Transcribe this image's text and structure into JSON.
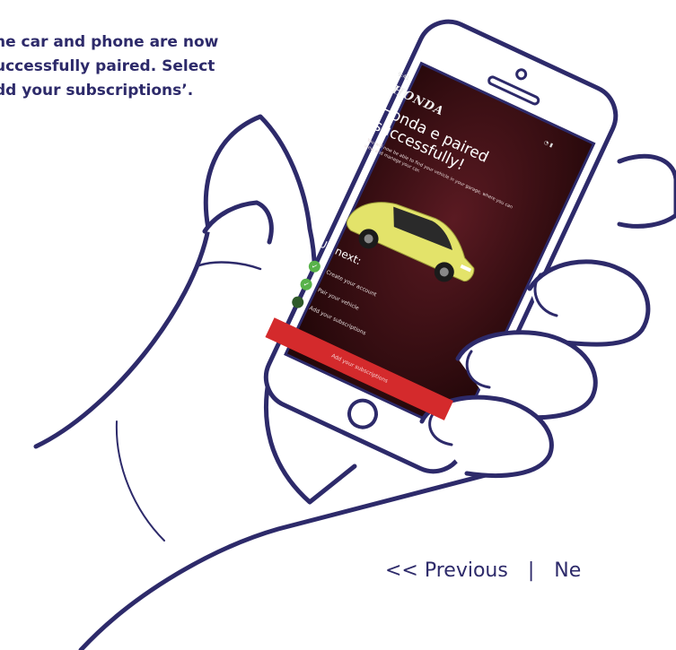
{
  "intro": {
    "lines": [
      "he car and phone are now",
      "uccessfully paired. Select",
      "dd your subscriptions’."
    ]
  },
  "phone_screen": {
    "status_time": "9:41",
    "status_icons": "◔ ▮",
    "brand": "HONDA",
    "title_lines": [
      "Honda e paired",
      "successfully!"
    ],
    "description": "You will now be able to find your vehicle in your garage, where you can view and manage your car.",
    "up_next_title": "Up next:",
    "steps": [
      {
        "label": "Create your account",
        "done": true
      },
      {
        "label": "Pair your vehicle",
        "done": true
      },
      {
        "label": "Add your subscriptions",
        "done": false
      }
    ],
    "cta_label": "Add your subscriptions"
  },
  "pager": {
    "previous_label": "<< Previous",
    "separator": "|",
    "next_label": "Ne"
  },
  "colors": {
    "ink": "#2d2a6a",
    "screen_bg": "#3a0f14",
    "cta": "#d42a2c",
    "car_yellow": "#e3e36a",
    "check_green": "#58b24a"
  }
}
